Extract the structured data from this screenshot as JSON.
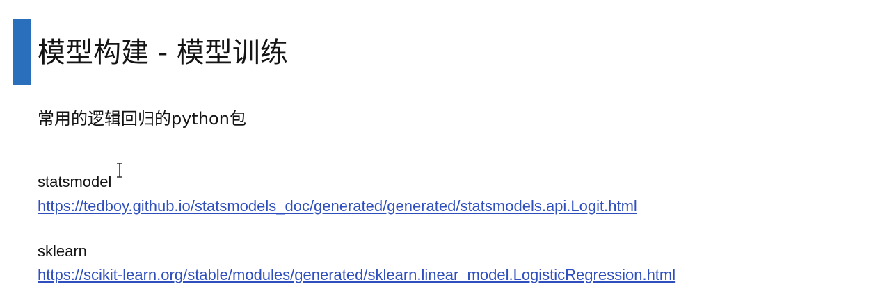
{
  "slide": {
    "title": "模型构建 - 模型训练",
    "subtitle": "常用的逻辑回归的python包",
    "accent_color": "#2a6fbb",
    "link_color": "#2f4fbf",
    "packages": [
      {
        "name": "statsmodel",
        "url": "https://tedboy.github.io/statsmodels_doc/generated/generated/statsmodels.api.Logit.html"
      },
      {
        "name": "sklearn",
        "url": "https://scikit-learn.org/stable/modules/generated/sklearn.linear_model.LogisticRegression.html"
      }
    ]
  },
  "cursor": {
    "icon": "text-cursor-icon"
  }
}
